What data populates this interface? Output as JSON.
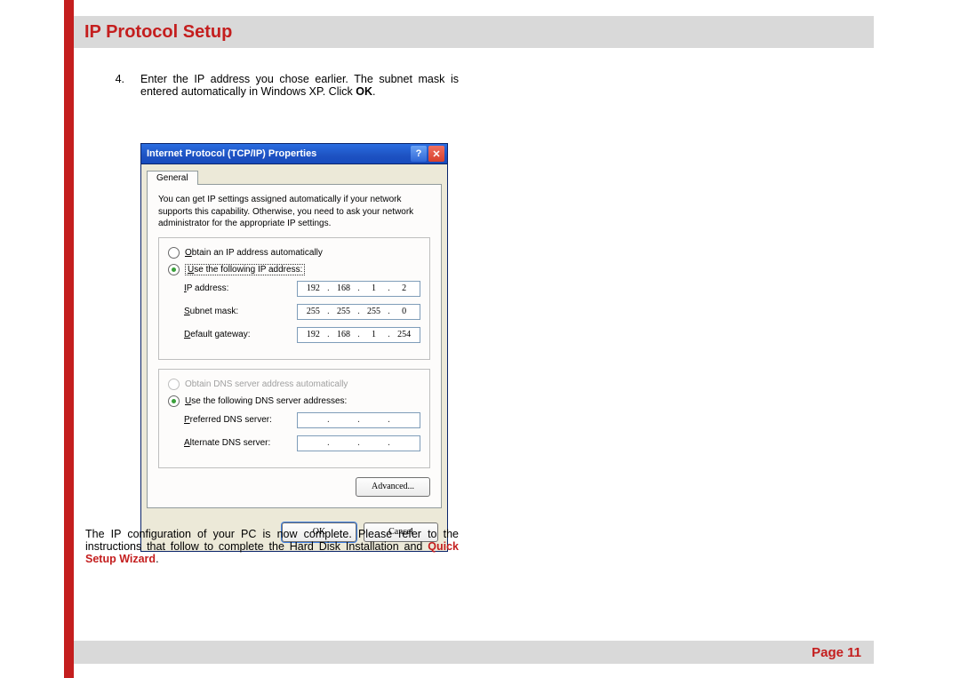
{
  "header": {
    "title": "IP Protocol Setup"
  },
  "step4": {
    "number": "4.",
    "text_a": "Enter the IP address you chose earlier. The subnet mask is entered automatically in Windows XP. Click ",
    "bold": "OK",
    "text_b": "."
  },
  "dialog": {
    "title": "Internet Protocol (TCP/IP) Properties",
    "tab": "General",
    "description": "You can get IP settings assigned automatically if your network supports this capability. Otherwise, you need to ask your network administrator for the appropriate IP settings.",
    "radio_auto_ip": {
      "label_pre": "O",
      "label_rest": "btain an IP address automatically"
    },
    "radio_manual_ip": {
      "label_pre": "U",
      "label_rest": "se the following IP address:"
    },
    "fields_ip": {
      "ip_label_pre": "I",
      "ip_label_rest": "P address:",
      "subnet_label_pre": "S",
      "subnet_label_rest": "ubnet mask:",
      "gateway_label_pre": "D",
      "gateway_label_rest": "efault gateway:",
      "ip": [
        "192",
        "168",
        "1",
        "2"
      ],
      "subnet": [
        "255",
        "255",
        "255",
        "0"
      ],
      "gateway": [
        "192",
        "168",
        "1",
        "254"
      ]
    },
    "radio_auto_dns": {
      "label_pre": "O",
      "label_rest": "btain DNS server address automatically"
    },
    "radio_manual_dns": {
      "label_pre": "U",
      "label_rest": "se the following DNS server addresses:"
    },
    "fields_dns": {
      "pref_label_pre": "P",
      "pref_label_rest": "referred DNS server:",
      "alt_label_pre": "A",
      "alt_label_rest": "lternate DNS server:"
    },
    "advanced_label": "Advanced...",
    "ok_label": "OK",
    "cancel_label": "Cancel",
    "help_glyph": "?",
    "close_glyph": "✕"
  },
  "below": {
    "text_a": "The IP configuration of your PC is now complete. Please refer to the instructions that follow to complete the Hard Disk Installation and ",
    "link": "Quick Setup Wizard",
    "text_b": "."
  },
  "footer": {
    "text": "Page 11"
  }
}
